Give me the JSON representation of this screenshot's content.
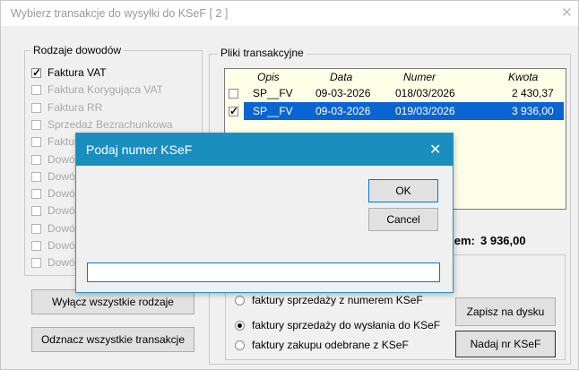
{
  "window": {
    "title": "Wybierz transakcje do wysyłki do KSeF  [ 2 ]",
    "close_glyph": "✕"
  },
  "left_group": {
    "legend": "Rodzaje dowodów",
    "items": [
      {
        "label": "Faktura VAT",
        "checked": true,
        "enabled": true
      },
      {
        "label": "Faktura Korygująca VAT",
        "checked": false,
        "enabled": false
      },
      {
        "label": "Faktura RR",
        "checked": false,
        "enabled": false
      },
      {
        "label": "Sprzedaż Bezrachunkowa",
        "checked": false,
        "enabled": false
      },
      {
        "label": "Faktur",
        "checked": false,
        "enabled": false
      },
      {
        "label": "Dowód",
        "checked": false,
        "enabled": false
      },
      {
        "label": "Dowód",
        "checked": false,
        "enabled": false
      },
      {
        "label": "Dowód",
        "checked": false,
        "enabled": false
      },
      {
        "label": "Dowód",
        "checked": false,
        "enabled": false
      },
      {
        "label": "Dowód",
        "checked": false,
        "enabled": false
      },
      {
        "label": "Dowód",
        "checked": false,
        "enabled": false
      },
      {
        "label": "Dowód",
        "checked": false,
        "enabled": false
      }
    ],
    "btn_disable_all": "Wyłącz wszystkie rodzaje",
    "btn_uncheck_all": "Odznacz wszystkie transakcje"
  },
  "right_group": {
    "legend": "Pliki transakcyjne",
    "columns": [
      "Opis",
      "Data",
      "Numer",
      "Kwota"
    ],
    "rows": [
      {
        "checked": false,
        "opis": "SP__FV",
        "data": "09-03-2026",
        "numer": "018/03/2026",
        "kwota": "2 430,37",
        "selected": false
      },
      {
        "checked": true,
        "opis": "SP__FV",
        "data": "09-03-2026",
        "numer": "019/03/2026",
        "kwota": "3 936,00",
        "selected": true
      }
    ],
    "total_label": "azem:",
    "total_value": "3 936,00"
  },
  "options": {
    "radios": [
      {
        "label": "faktury sprzedaży z numerem KSeF",
        "selected": false
      },
      {
        "label": "faktury sprzedaży do wysłania do KSeF",
        "selected": true
      },
      {
        "label": "faktury zakupu odebrane z KSeF",
        "selected": false
      }
    ],
    "btn_save": "Zapisz na dysku",
    "btn_assign": "Nadaj nr KSeF"
  },
  "dialog": {
    "title": "Podaj numer KSeF",
    "close_glyph": "✕",
    "ok_label": "OK",
    "cancel_label": "Cancel",
    "input_value": ""
  },
  "colors": {
    "selection": "#0a64d2",
    "dialog_title": "#1b8ec0",
    "table_bg": "#ffffe8"
  }
}
